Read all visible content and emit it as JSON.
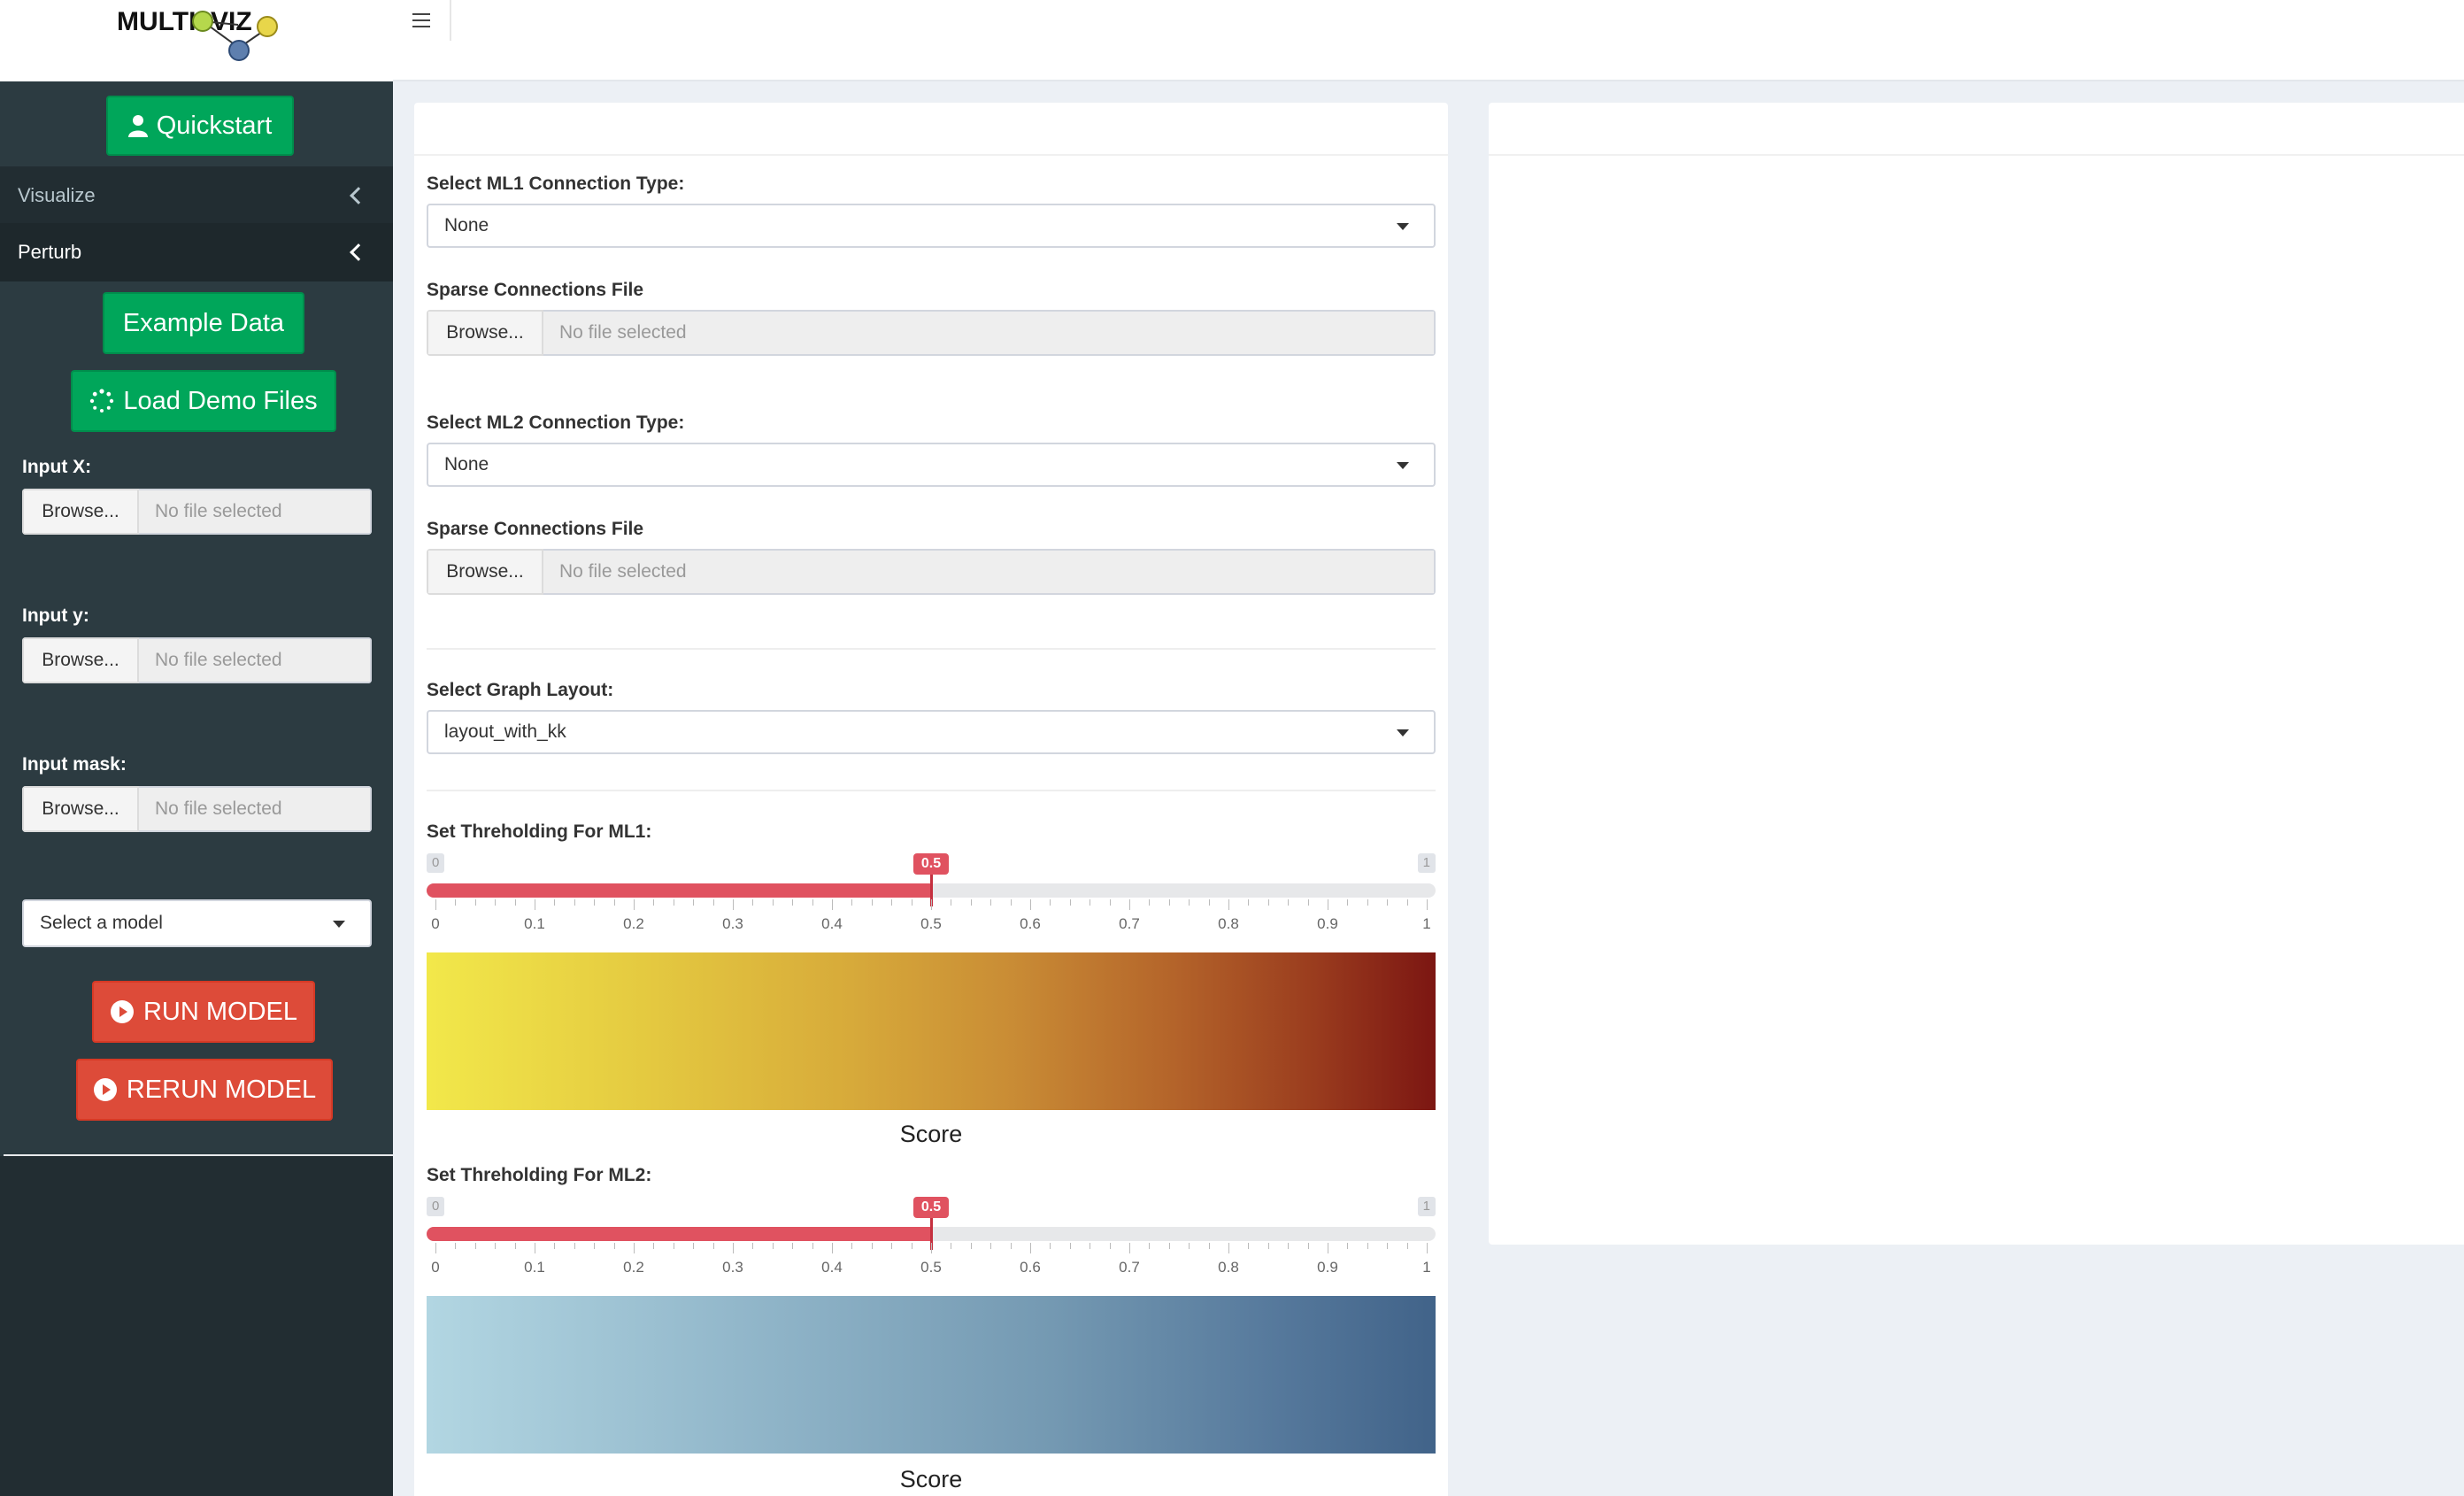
{
  "logo": {
    "text": "MULTIOVIZ"
  },
  "sidebar": {
    "quickstart_label": "Quickstart",
    "menu": [
      {
        "label": "Visualize"
      },
      {
        "label": "Perturb"
      }
    ],
    "example_data_label": "Example Data",
    "load_demo_label": "Load Demo Files",
    "inputs": [
      {
        "label": "Input X:",
        "browse": "Browse...",
        "file": "No file selected"
      },
      {
        "label": "Input y:",
        "browse": "Browse...",
        "file": "No file selected"
      },
      {
        "label": "Input mask:",
        "browse": "Browse...",
        "file": "No file selected"
      }
    ],
    "model_select": "Select a model",
    "run_label": "RUN MODEL",
    "rerun_label": "RERUN MODEL"
  },
  "main": {
    "ml1_conn_label": "Select ML1 Connection Type:",
    "ml1_conn_value": "None",
    "sparse1_label": "Sparse Connections File",
    "sparse1_browse": "Browse...",
    "sparse1_file": "No file selected",
    "ml2_conn_label": "Select ML2 Connection Type:",
    "ml2_conn_value": "None",
    "sparse2_label": "Sparse Connections File",
    "sparse2_browse": "Browse...",
    "sparse2_file": "No file selected",
    "layout_label": "Select Graph Layout:",
    "layout_value": "layout_with_kk",
    "thresh1": {
      "label": "Set Threholding For ML1:",
      "min": "0",
      "max": "1",
      "value": 0.5,
      "value_label": "0.5",
      "ticks": [
        "0",
        "0.1",
        "0.2",
        "0.3",
        "0.4",
        "0.5",
        "0.6",
        "0.7",
        "0.8",
        "0.9",
        "1"
      ],
      "legend_title": "Score"
    },
    "thresh2": {
      "label": "Set Threholding For ML2:",
      "min": "0",
      "max": "1",
      "value": 0.5,
      "value_label": "0.5",
      "ticks": [
        "0",
        "0.1",
        "0.2",
        "0.3",
        "0.4",
        "0.5",
        "0.6",
        "0.7",
        "0.8",
        "0.9",
        "1"
      ],
      "legend_title": "Score"
    }
  },
  "colors": {
    "green": "#00a65a",
    "red": "#dd4b39",
    "slider": "#e05260",
    "sidebar_bg": "#222d32"
  }
}
